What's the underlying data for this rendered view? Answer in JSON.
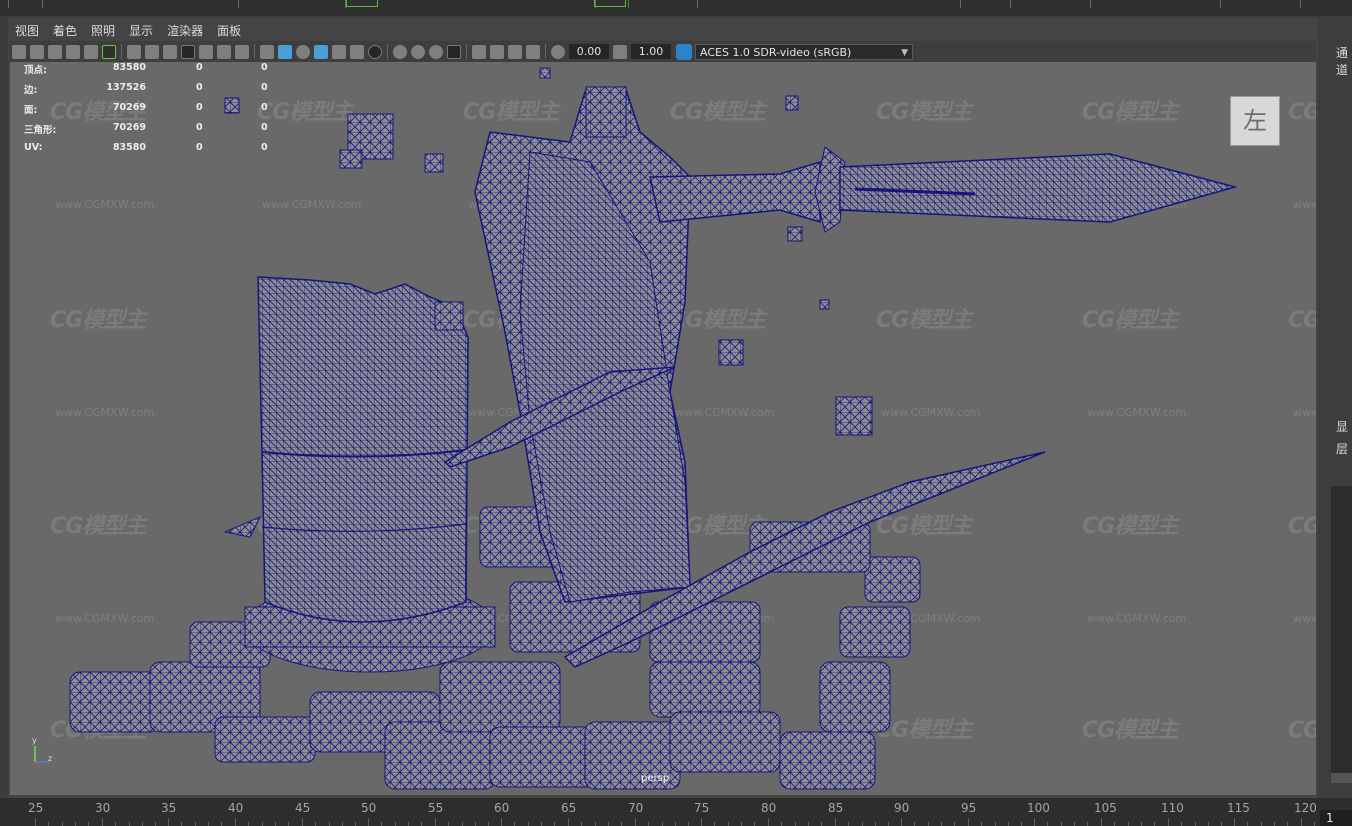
{
  "menu": [
    "视图",
    "着色",
    "照明",
    "显示",
    "渲染器",
    "面板"
  ],
  "toolbar": {
    "exposure_value": "0.00",
    "gamma_value": "1.00",
    "color_space": "ACES 1.0 SDR-video (sRGB)"
  },
  "heads_up": [
    {
      "label": "顶点:",
      "a": "83580",
      "b": "0",
      "c": "0"
    },
    {
      "label": "边:",
      "a": "137526",
      "b": "0",
      "c": "0"
    },
    {
      "label": "面:",
      "a": "70269",
      "b": "0",
      "c": "0"
    },
    {
      "label": "三角形:",
      "a": "70269",
      "b": "0",
      "c": "0"
    },
    {
      "label": "UV:",
      "a": "83580",
      "b": "0",
      "c": "0"
    }
  ],
  "viewport": {
    "camera_label": "persp",
    "viewcube_face": "左",
    "wireframe_color": "#16167a",
    "mesh_color": "#8e8e93",
    "background_color": "#696969"
  },
  "watermark": {
    "logo": "CG模型主",
    "url": "www.CGMXW.com"
  },
  "axes": {
    "y": "y",
    "z": "z"
  },
  "right_panel": {
    "tab_top": "通道",
    "item_1": "显",
    "item_2": "层"
  },
  "timeline": {
    "ticks": [
      "25",
      "30",
      "35",
      "40",
      "45",
      "50",
      "55",
      "60",
      "65",
      "70",
      "75",
      "80",
      "85",
      "90",
      "95",
      "100",
      "105",
      "110",
      "115",
      "120"
    ],
    "current_frame": "1"
  }
}
